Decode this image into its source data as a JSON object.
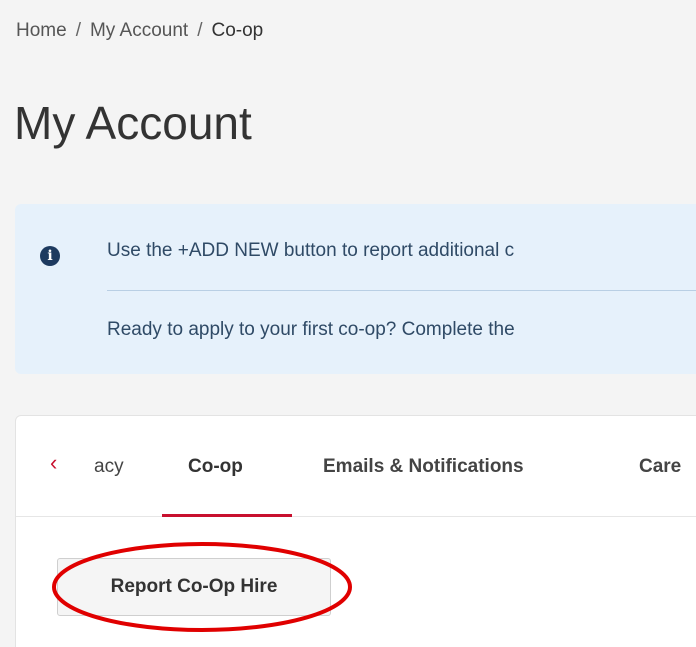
{
  "breadcrumb": {
    "items": [
      "Home",
      "My Account",
      "Co-op"
    ],
    "separator": "/"
  },
  "page": {
    "title": "My Account"
  },
  "banner": {
    "icon": "info-icon",
    "icon_glyph": "i",
    "line1": "Use the +ADD NEW button to report additional c",
    "line2": "Ready to apply to your first co-op? Complete the",
    "color_bg": "#e6f1fb"
  },
  "tabs": {
    "prev_icon": "chevron-left-icon",
    "prev_glyph": "‹",
    "items": [
      {
        "label": "acy",
        "active": false
      },
      {
        "label": "Co-op",
        "active": true
      },
      {
        "label": "Emails & Notifications",
        "active": false
      },
      {
        "label": "Care",
        "active": false
      }
    ],
    "accent_color": "#c8102e"
  },
  "actions": {
    "report_hire_label": "Report Co-Op Hire"
  },
  "annotation": {
    "shape": "ellipse",
    "color": "#e00000"
  }
}
